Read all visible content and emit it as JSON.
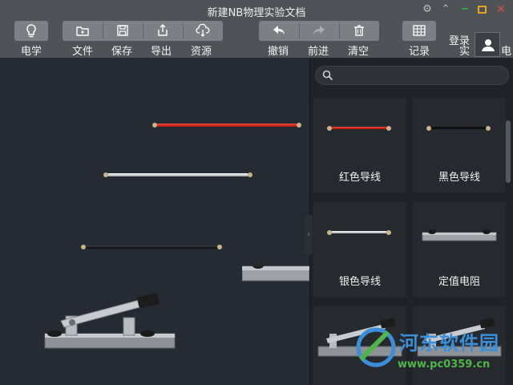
{
  "window": {
    "title": "新建NB物理实验文档",
    "controls": [
      "gear-icon",
      "chevron-up-icon",
      "minimize-icon",
      "maximize-icon",
      "close-icon"
    ],
    "control_colors": {
      "minimize": "#2fb043",
      "maximize": "#e5a21a",
      "close": "#e04a3c"
    }
  },
  "toolbar": {
    "electricity": {
      "label": "电学",
      "icon": "lightbulb-icon"
    },
    "file": {
      "label": "文件",
      "icon": "folder-icon"
    },
    "save": {
      "label": "保存",
      "icon": "save-icon"
    },
    "export": {
      "label": "导出",
      "icon": "export-icon"
    },
    "resources": {
      "label": "资源",
      "icon": "cloud-download-icon"
    },
    "undo": {
      "label": "撤销",
      "icon": "undo-arrow-icon"
    },
    "redo": {
      "label": "前进",
      "icon": "redo-arrow-icon"
    },
    "clear": {
      "label": "清空",
      "icon": "trash-icon"
    },
    "record": {
      "label": "记录",
      "icon": "table-grid-icon"
    },
    "login": {
      "label": "登录",
      "icon": "user-avatar-icon"
    },
    "experiment_clip": "实",
    "right_clip": "电"
  },
  "canvas": {
    "components": [
      {
        "type": "red-wire",
        "color": "#d0221a"
      },
      {
        "type": "silver-wire",
        "color": "#cfd2d6"
      },
      {
        "type": "black-wire",
        "color": "#16181b"
      },
      {
        "type": "knife-switch",
        "icon": "knife-switch-icon"
      },
      {
        "type": "fixed-resistor-partial",
        "icon": "resistor-icon"
      }
    ]
  },
  "panel": {
    "search": {
      "placeholder": "",
      "value": ""
    },
    "items": [
      {
        "label": "红色导线",
        "color": "#e0382d",
        "icon": "red-wire-icon"
      },
      {
        "label": "黑色导线",
        "color": "#111111",
        "icon": "black-wire-icon"
      },
      {
        "label": "银色导线",
        "color": "#d4d7da",
        "icon": "silver-wire-icon"
      },
      {
        "label": "定值电阻",
        "color": "#9a9a9a",
        "icon": "resistor-icon"
      },
      {
        "label": "",
        "icon": "knife-switch-icon"
      },
      {
        "label": "",
        "icon": "knife-switch-icon"
      }
    ]
  },
  "watermark": {
    "name": "河东软件园",
    "url": "www.pc0359.cn"
  }
}
